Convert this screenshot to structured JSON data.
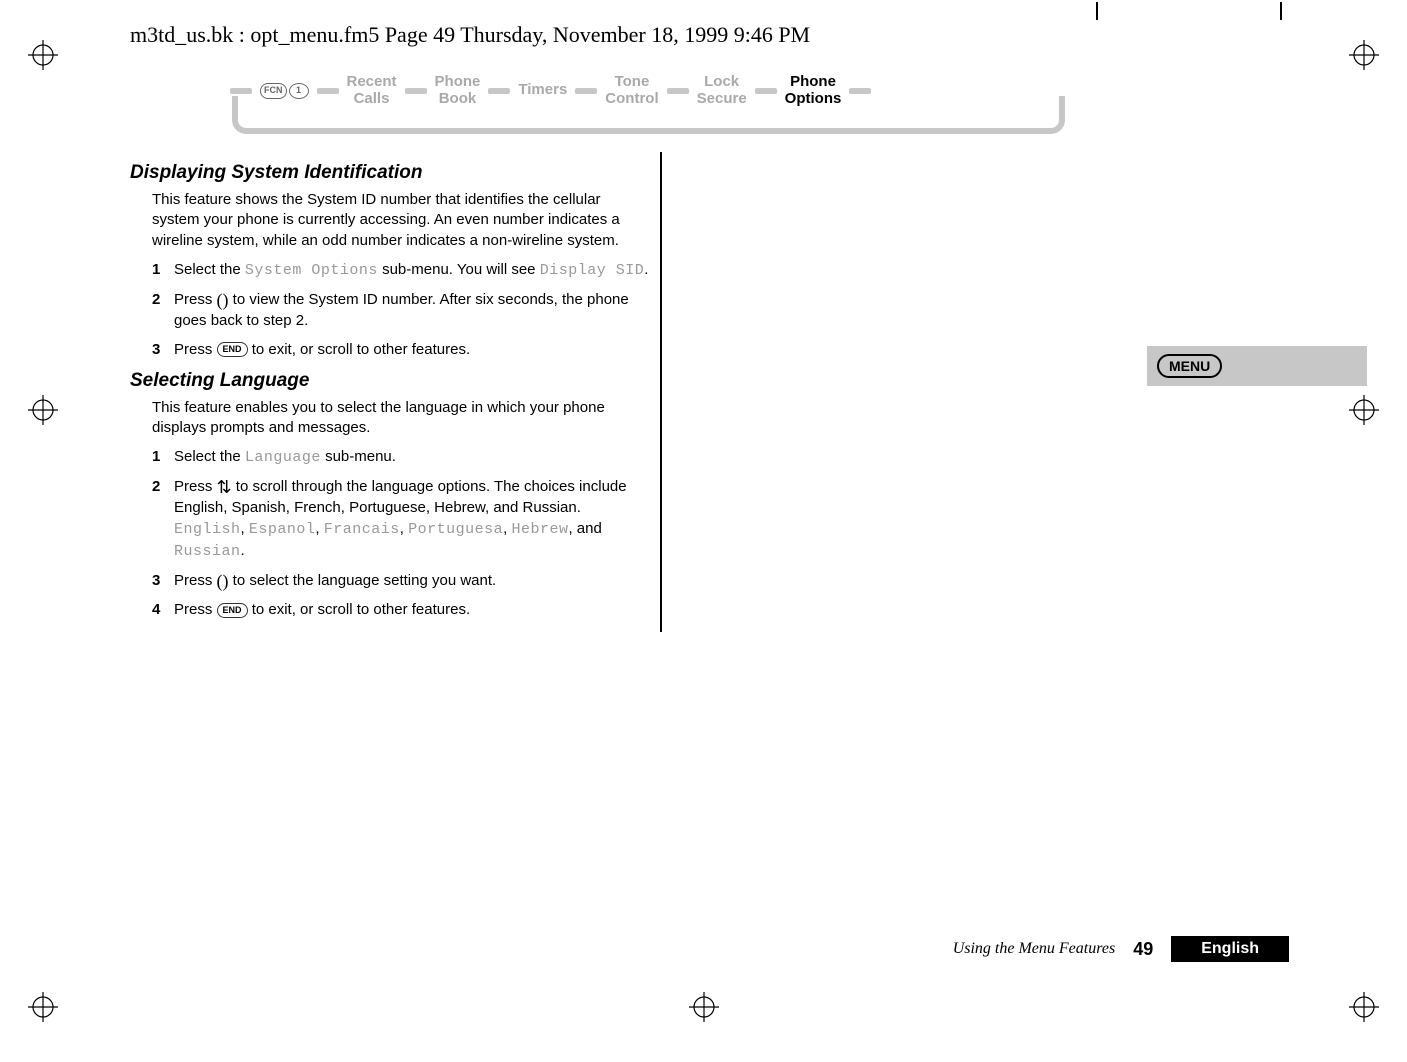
{
  "header_path": "m3td_us.bk : opt_menu.fm5  Page 49  Thursday, November 18, 1999  9:46 PM",
  "menu": {
    "fcn_label": "FCN",
    "one_label": "1",
    "items": [
      {
        "line1": "Recent",
        "line2": "Calls",
        "active": false
      },
      {
        "line1": "Phone",
        "line2": "Book",
        "active": false
      },
      {
        "line1": "Timers",
        "line2": "",
        "active": false
      },
      {
        "line1": "Tone",
        "line2": "Control",
        "active": false
      },
      {
        "line1": "Lock",
        "line2": "Secure",
        "active": false
      },
      {
        "line1": "Phone",
        "line2": "Options",
        "active": true
      }
    ]
  },
  "sections": {
    "sect1_title": "Displaying System Identification",
    "sect1_para": "This feature shows the System ID number that identifies the cellular system your phone is currently accessing. An even number indicates a wireline system, while an odd number indicates a non-wireline system.",
    "sect1_step1_pre": "Select the ",
    "sect1_step1_mono1": "System Options",
    "sect1_step1_mid": " sub-menu. You will see ",
    "sect1_step1_mono2": "Display SID",
    "sect1_step1_post": ".",
    "sect1_step2_pre": "Press ",
    "sect1_step2_key": "()",
    "sect1_step2_post": " to view the System ID number. After six seconds, the phone goes back to step 2.",
    "sect1_step3_pre": "Press ",
    "sect1_step3_key": "END",
    "sect1_step3_post": " to exit, or scroll to other features.",
    "sect2_title": "Selecting Language",
    "sect2_para": "This feature enables you to select the language in which your phone displays prompts and messages.",
    "sect2_step1_pre": "Select the ",
    "sect2_step1_mono": "Language",
    "sect2_step1_post": " sub-menu.",
    "sect2_step2_pre": "Press ",
    "sect2_step2_key": "⇅",
    "sect2_step2_mid": " to scroll through the language options. The choices include English, Spanish, French, Portuguese, Hebrew, and Russian. ",
    "sect2_step2_mono_list": "English",
    "sect2_step2_m2": "Espanol",
    "sect2_step2_m3": "Francais",
    "sect2_step2_m4": "Portuguesa",
    "sect2_step2_m5": "Hebrew",
    "sect2_step2_and": ", and ",
    "sect2_step2_m6": "Russian",
    "sect2_step2_post": ".",
    "sect2_step3_pre": "Press ",
    "sect2_step3_key": "()",
    "sect2_step3_post": " to select the language setting you want.",
    "sect2_step4_pre": "Press ",
    "sect2_step4_key": "END",
    "sect2_step4_post": " to exit, or scroll to other features."
  },
  "side_tab": "MENU",
  "footer": {
    "text": "Using the Menu Features",
    "page": "49",
    "lang": "English"
  }
}
